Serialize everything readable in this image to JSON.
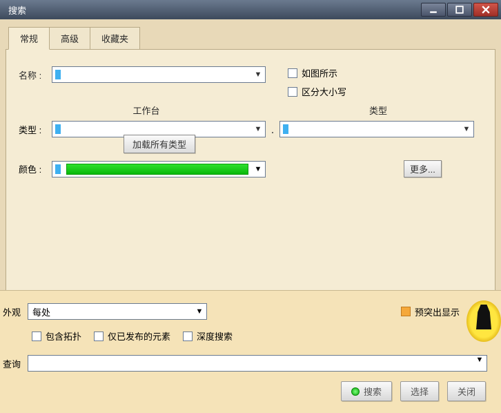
{
  "window": {
    "title": "搜索"
  },
  "tabs": {
    "t0": "常规",
    "t1": "高级",
    "t2": "收藏夹"
  },
  "fields": {
    "name_label": "名称 :",
    "type_label": "类型 :",
    "color_label": "颜色 :",
    "workbench_header": "工作台",
    "category_header": "类型",
    "show_as_image": "如图所示",
    "case_sensitive": "区分大小写",
    "load_all_types": "加载所有类型",
    "more": "更多..."
  },
  "colors": {
    "swatch": "#1cc81c"
  },
  "lower": {
    "appearance_label": "外观",
    "appearance_value": "每处",
    "highlight_label": "预突出显示",
    "include_topology": "包含拓扑",
    "published_only": "仅已发布的元素",
    "deep_search": "深度搜索",
    "query_label": "查询"
  },
  "footer": {
    "search": "搜索",
    "select": "选择",
    "close": "关闭"
  }
}
